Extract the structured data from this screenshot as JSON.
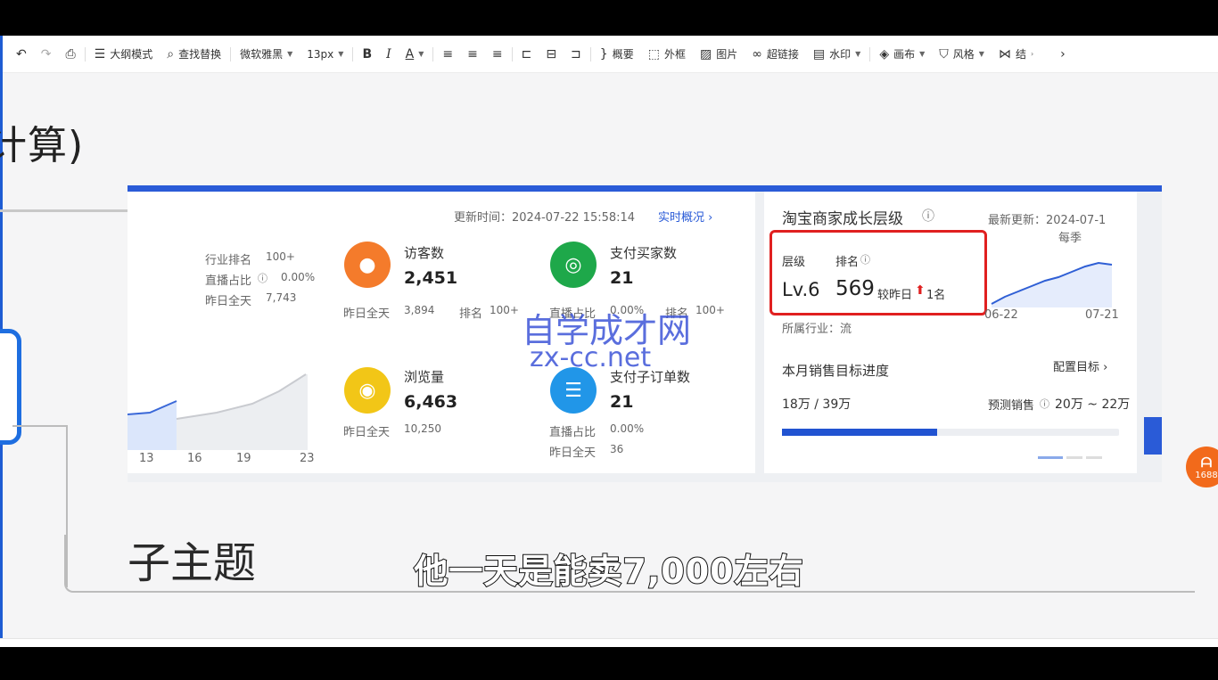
{
  "toolbar": {
    "outline_mode": "大纲模式",
    "find_replace": "查找替换",
    "font_family": "微软雅黑",
    "font_size": "13px",
    "bold": "B",
    "italic": "I",
    "font_color": "A",
    "summary": "概要",
    "frame": "外框",
    "image": "图片",
    "hyperlink": "超链接",
    "watermark": "水印",
    "canvas": "画布",
    "style": "风格",
    "more": "结"
  },
  "canvas": {
    "title_fragment": "计算)",
    "subtopic": "子主题"
  },
  "dashboard": {
    "update_time_label": "更新时间：2024-07-22 15:58:14",
    "realtime_link": "实时概况",
    "left_stats": {
      "industry_rank_label": "行业排名",
      "industry_rank_value": "100+",
      "live_ratio_label": "直播占比",
      "live_ratio_value": "0.00%",
      "yesterday_label": "昨日全天",
      "yesterday_value": "7,743"
    },
    "visitors": {
      "label": "访客数",
      "value": "2,451",
      "yesterday_label": "昨日全天",
      "yesterday_value": "3,894",
      "rank_label": "排名",
      "rank_value": "100+"
    },
    "buyers": {
      "label": "支付买家数",
      "value": "21",
      "live_ratio_label": "直播占比",
      "live_ratio_value": "0.00%",
      "rank_label": "排名",
      "rank_value": "100+"
    },
    "pageviews": {
      "label": "浏览量",
      "value": "6,463",
      "yesterday_label": "昨日全天",
      "yesterday_value": "10,250"
    },
    "suborders": {
      "label": "支付子订单数",
      "value": "21",
      "live_ratio_label": "直播占比",
      "live_ratio_value": "0.00%",
      "yesterday_label": "昨日全天",
      "yesterday_value": "36"
    },
    "mini_chart_ticks": [
      "13",
      "16",
      "19",
      "23"
    ],
    "growth": {
      "title": "淘宝商家成长层级",
      "latest_update": "最新更新：2024-07-1",
      "every_season": "每季",
      "level_label": "层级",
      "rank_label": "排名",
      "level_value": "Lv.6",
      "rank_value": "569",
      "compare_label": "较昨日",
      "compare_value": "1名",
      "chart_ticks": [
        "06-22",
        "07-21"
      ],
      "industry_label": "所属行业：流",
      "monthly_target_label": "本月销售目标进度",
      "config_target": "配置目标",
      "progress_text": "18万 / 39万",
      "progress_fraction": 0.4615,
      "forecast_label": "预测销售",
      "forecast_value": "20万 ~ 22万"
    }
  },
  "watermark": {
    "line1": "自学成才网",
    "line2": "zx-cc.net"
  },
  "subtitle": "他一天是能卖7,000左右",
  "badge": {
    "text": "1688"
  },
  "colors": {
    "accent": "#2a5bd7",
    "orange": "#f47b2b",
    "green": "#1ea84a",
    "yellow": "#f2c617",
    "blue": "#2196e8",
    "red": "#e02020"
  }
}
